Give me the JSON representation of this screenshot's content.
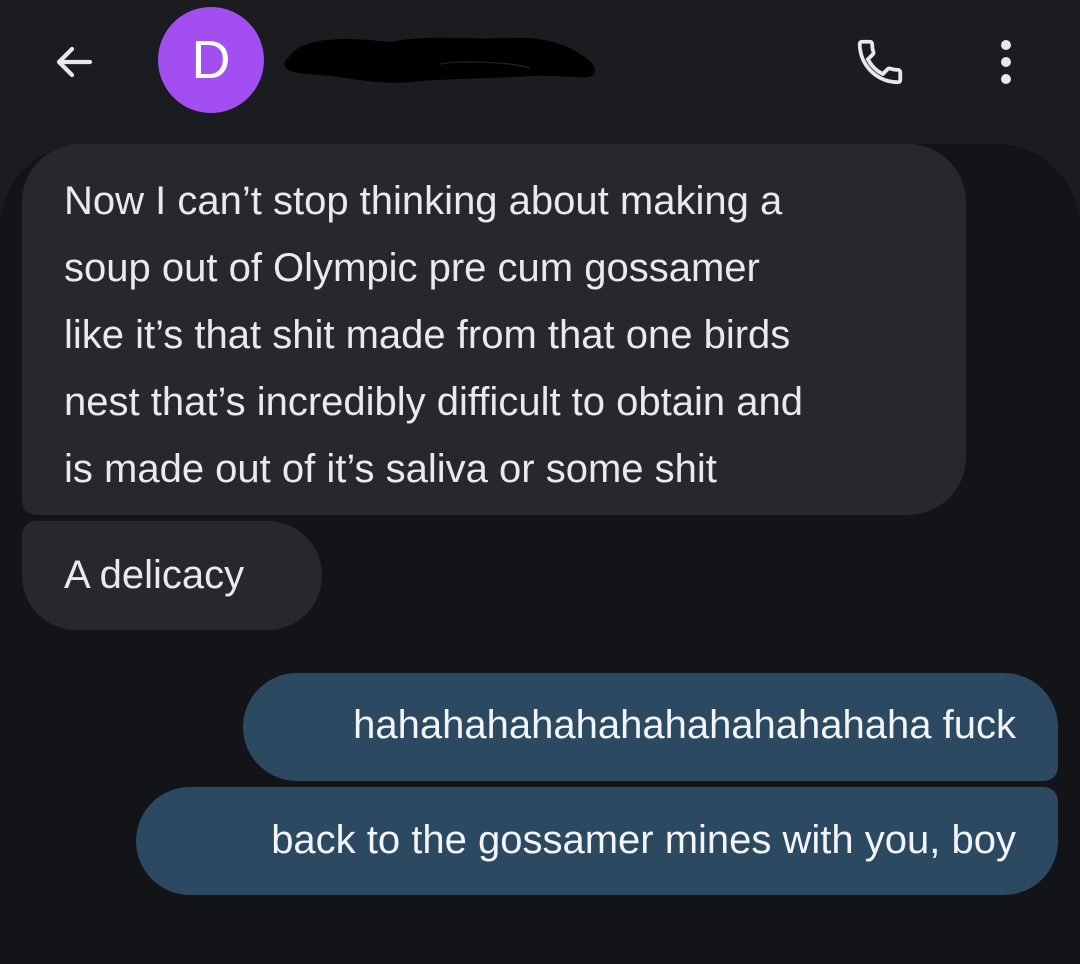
{
  "header": {
    "back_icon": "arrow-left-icon",
    "avatar_letter": "D",
    "avatar_color": "#a24ef0",
    "call_icon": "phone-icon",
    "more_icon": "more-vert-icon"
  },
  "messages": [
    {
      "direction": "incoming",
      "lines": [
        "Now I can’t stop thinking about making a",
        "soup out of Olympic pre cum gossamer",
        "like it’s that shit made from that one birds",
        "nest that’s incredibly difficult to obtain and",
        "is made out of it’s saliva or some shit"
      ]
    },
    {
      "direction": "incoming",
      "text": "A delicacy"
    },
    {
      "direction": "outgoing",
      "text": "hahahahahahahahahahahahaha fuck"
    },
    {
      "direction": "outgoing",
      "text": "back to the gossamer mines with you, boy"
    }
  ],
  "colors": {
    "background": "#1b1c20",
    "thread_background": "#131418",
    "incoming_bubble": "#27282c",
    "outgoing_bubble": "#2b4961",
    "text": "#e9e9ee"
  }
}
